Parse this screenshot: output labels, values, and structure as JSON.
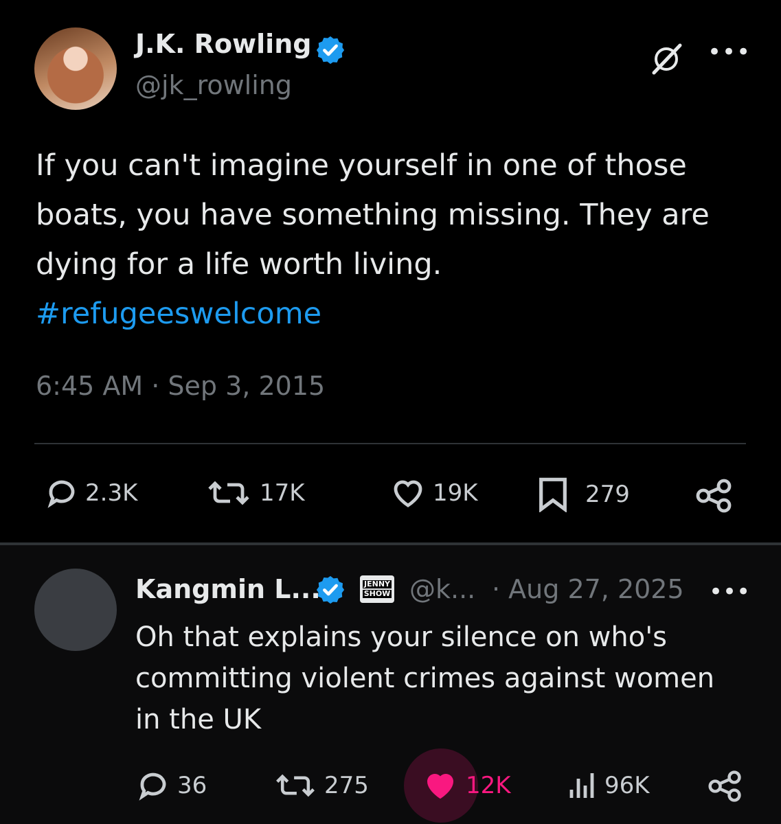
{
  "tweet": {
    "author_name": "J.K. Rowling",
    "handle": "@jk_rowling",
    "text_lines": [
      "If you can't imagine yourself in one of those",
      "boats, you have something missing. They are",
      "dying for a life worth living."
    ],
    "hashtag": "#refugeeswelcome",
    "timestamp": "6:45 AM · Sep 3, 2015",
    "stats": {
      "replies": "2.3K",
      "reposts": "17K",
      "likes": "19K",
      "bookmarks": "279"
    }
  },
  "reply": {
    "author_name": "Kangmin L...",
    "badge_text_1": "JENNY",
    "badge_text_2": "SHOW",
    "handle": "@k...",
    "date": "· Aug 27, 2025",
    "text_lines": [
      "Oh that explains your silence on who's",
      "committing violent crimes against women",
      "in the UK"
    ],
    "stats": {
      "replies": "36",
      "reposts": "275",
      "likes": "12K",
      "views": "96K"
    }
  },
  "menu": {
    "more_glyph": "•••"
  },
  "colors": {
    "background": "#000000",
    "text": "#e7e9ea",
    "muted": "#71767b",
    "link": "#1d9bf0",
    "verified": "#1d9bf0",
    "liked": "#f91880"
  },
  "icons": [
    "grok-icon",
    "more-icon",
    "reply-icon",
    "repost-icon",
    "like-icon",
    "bookmark-icon",
    "share-icon",
    "views-icon",
    "verified-icon"
  ]
}
